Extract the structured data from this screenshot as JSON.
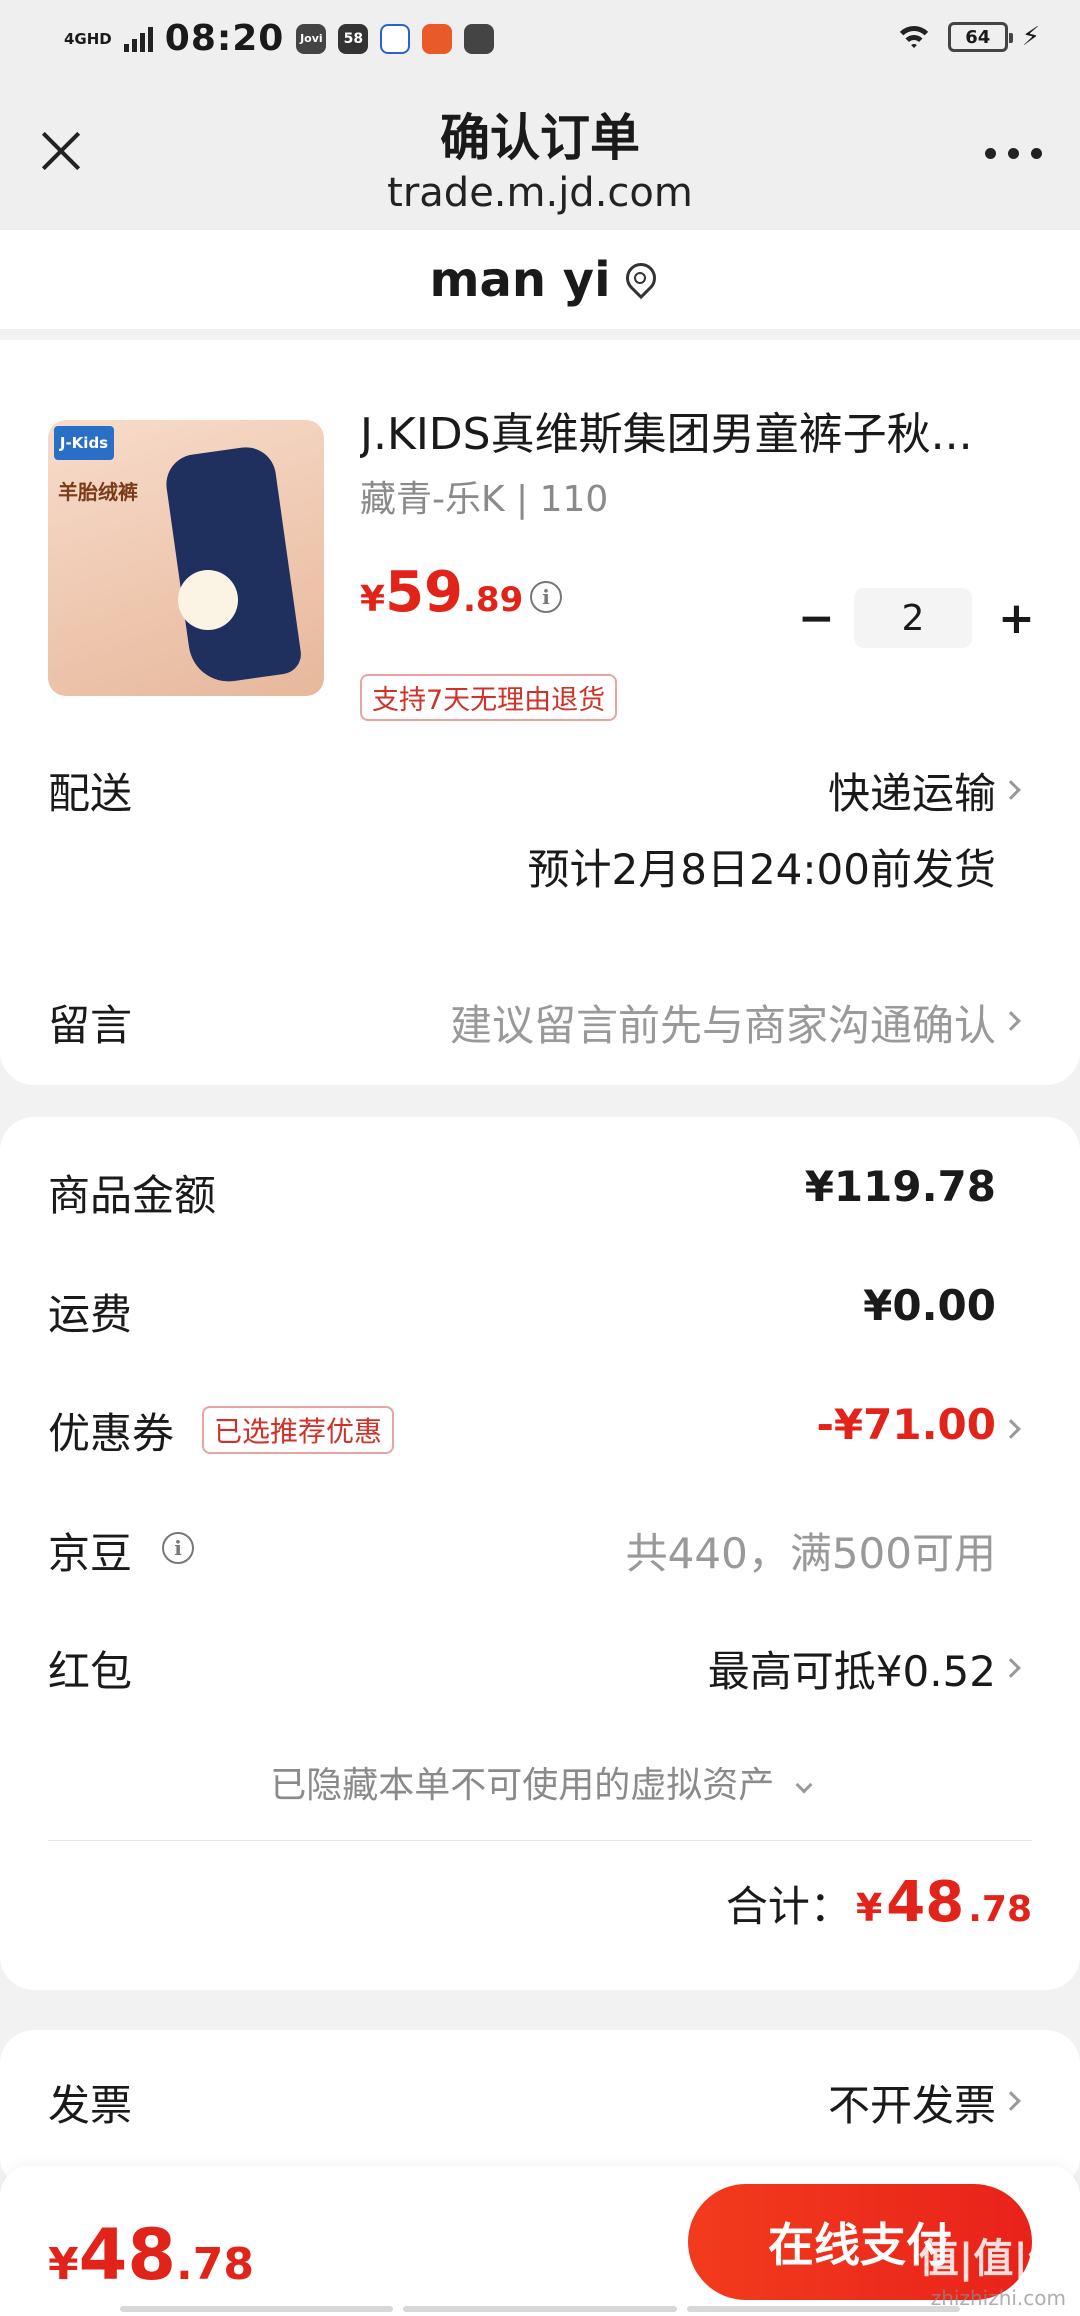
{
  "status_bar": {
    "network": "4GHD",
    "time": "08:20",
    "apps": [
      "Jovi",
      "58",
      "",
      "",
      ""
    ],
    "battery": "64"
  },
  "header": {
    "title": "确认订单",
    "url": "trade.m.jd.com"
  },
  "address": {
    "name": "man yi"
  },
  "product": {
    "image_badge": "J-Kids",
    "image_tag": "羊胎绒裤",
    "name": "J.KIDS真维斯集团男童裤子秋...",
    "spec": "藏青-乐K | 110",
    "price_currency": "¥",
    "price_int": "59",
    "price_dec": ".89",
    "quantity": "2",
    "minus": "−",
    "plus": "+",
    "return_policy": "支持7天无理由退货"
  },
  "delivery": {
    "label": "配送",
    "method": "快递运输",
    "estimate": "预计2月8日24:00前发货"
  },
  "message": {
    "label": "留言",
    "placeholder": "建议留言前先与商家沟通确认"
  },
  "summary": {
    "goods_label": "商品金额",
    "goods_value": "¥119.78",
    "shipping_label": "运费",
    "shipping_value": "¥0.00",
    "coupon_label": "优惠券",
    "coupon_badge": "已选推荐优惠",
    "coupon_value": "-¥71.00",
    "beans_label": "京豆",
    "beans_value": "共440，满500可用",
    "redpacket_label": "红包",
    "redpacket_value": "最高可抵¥0.52",
    "hidden_assets": "已隐藏本单不可使用的虚拟资产",
    "total_label": "合计：",
    "total_currency": "¥",
    "total_int": "48",
    "total_dec": ".78"
  },
  "invoice": {
    "label": "发票",
    "value": "不开发票"
  },
  "bottom": {
    "currency": "¥",
    "int": "48",
    "dec": ".78",
    "pay_label": "在线支付",
    "watermark": "值|值|值",
    "watermark_sub": "zhizhizhi.com"
  },
  "colors": {
    "price_red": "#e2231a",
    "pay_button": "#e9221a",
    "badge_border": "#e8a4a0"
  }
}
